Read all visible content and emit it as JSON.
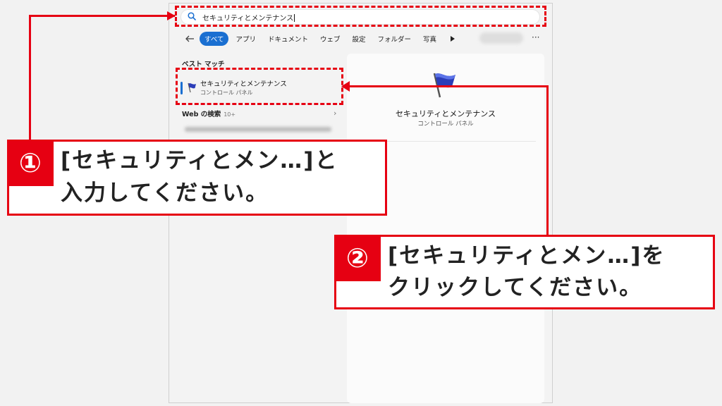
{
  "search": {
    "query": "セキュリティとメンテナンス"
  },
  "tabs": [
    "すべて",
    "アプリ",
    "ドキュメント",
    "ウェブ",
    "設定",
    "フォルダー",
    "写真"
  ],
  "more_label": "···",
  "best_match": {
    "heading": "ベスト マッチ",
    "title": "セキュリティとメンテナンス",
    "subtitle": "コントロール パネル"
  },
  "web_search": {
    "label": "Web の検索",
    "count": "10+",
    "chevron": "›"
  },
  "detail_panel": {
    "title": "セキュリティとメンテナンス",
    "subtitle": "コントロール パネル"
  },
  "callout1": {
    "number": "①",
    "line1": "[セキュリティとメン…]と",
    "line2": "入力してください。"
  },
  "callout2": {
    "number": "②",
    "line1": "[セキュリティとメン…]を",
    "line2": "クリックしてください。"
  },
  "colors": {
    "accent_red": "#e60012",
    "windows_blue": "#1a6fd1"
  }
}
